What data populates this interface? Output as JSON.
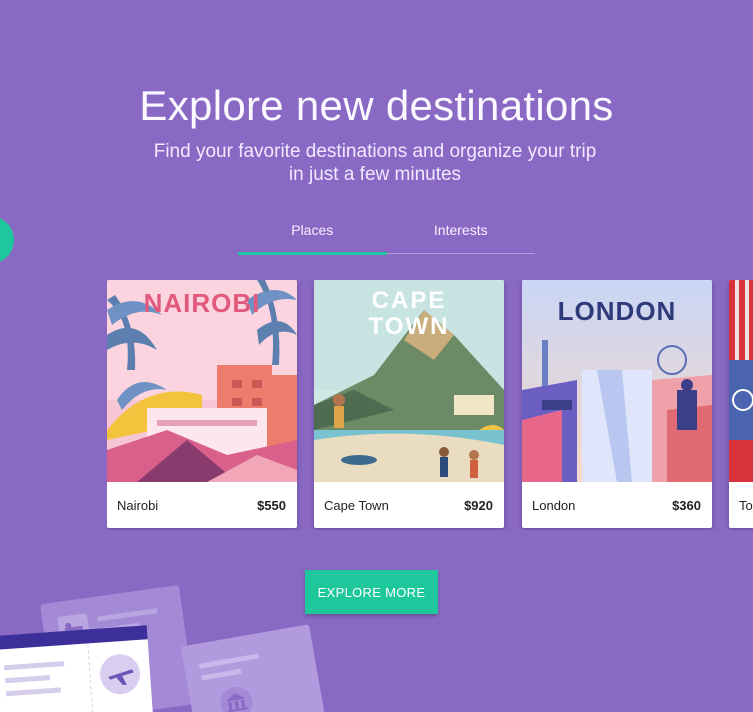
{
  "hero": {
    "title": "Explore new destinations",
    "subtitle": "Find your favorite destinations and organize your trip in just a few minutes"
  },
  "tabs": [
    {
      "label": "Places",
      "active": true
    },
    {
      "label": "Interests",
      "active": false
    }
  ],
  "cards": [
    {
      "poster_text": "NAIROBI",
      "name": "Nairobi",
      "price": "$550"
    },
    {
      "poster_text_line1": "CAPE",
      "poster_text_line2": "TOWN",
      "name": "Cape Town",
      "price": "$920"
    },
    {
      "poster_text": "LONDON",
      "name": "London",
      "price": "$360"
    },
    {
      "name": "To",
      "price": ""
    }
  ],
  "explore_button": {
    "label": "EXPLORE MORE"
  },
  "colors": {
    "background": "#8a69c4",
    "accent": "#1ec89c",
    "card_bg": "#ffffff"
  },
  "icons": [
    "bed-icon",
    "plane-icon",
    "museum-icon"
  ]
}
